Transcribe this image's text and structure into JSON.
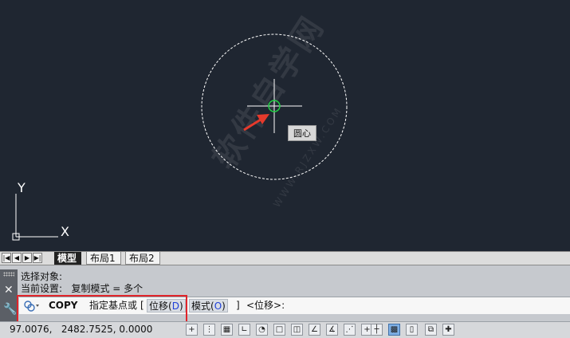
{
  "viewport": {
    "tooltip": "圆心",
    "ucs_y_label": "Y",
    "ucs_x_label": "X",
    "watermark": "软件自学网",
    "watermark_url": "WWW.RJZXW.COM",
    "colors": {
      "background": "#1f2631",
      "circle": "#ffffff",
      "osnap_marker": "#22cc44",
      "arrow": "#e53a2c"
    }
  },
  "layout_tabs": {
    "nav_buttons": [
      "first-icon",
      "prev-icon",
      "next-icon",
      "last-icon"
    ],
    "tabs": [
      {
        "label": "模型",
        "active": true
      },
      {
        "label": "布局1",
        "active": false
      },
      {
        "label": "布局2",
        "active": false
      }
    ]
  },
  "command": {
    "history": [
      "选择对象:",
      "当前设置:   复制模式 = 多个"
    ],
    "name": "COPY",
    "prompt": "指定基点或",
    "open_bracket": "[",
    "options": [
      {
        "label": "位移(",
        "key": "D",
        "end": ")"
      },
      {
        "label": "模式(",
        "key": "O",
        "end": ")"
      }
    ],
    "close_bracket": "]",
    "default": "<位移>:",
    "highlight_color": "#e0242a"
  },
  "status": {
    "coordinates": "97.0076,   2482.7525, 0.0000"
  }
}
